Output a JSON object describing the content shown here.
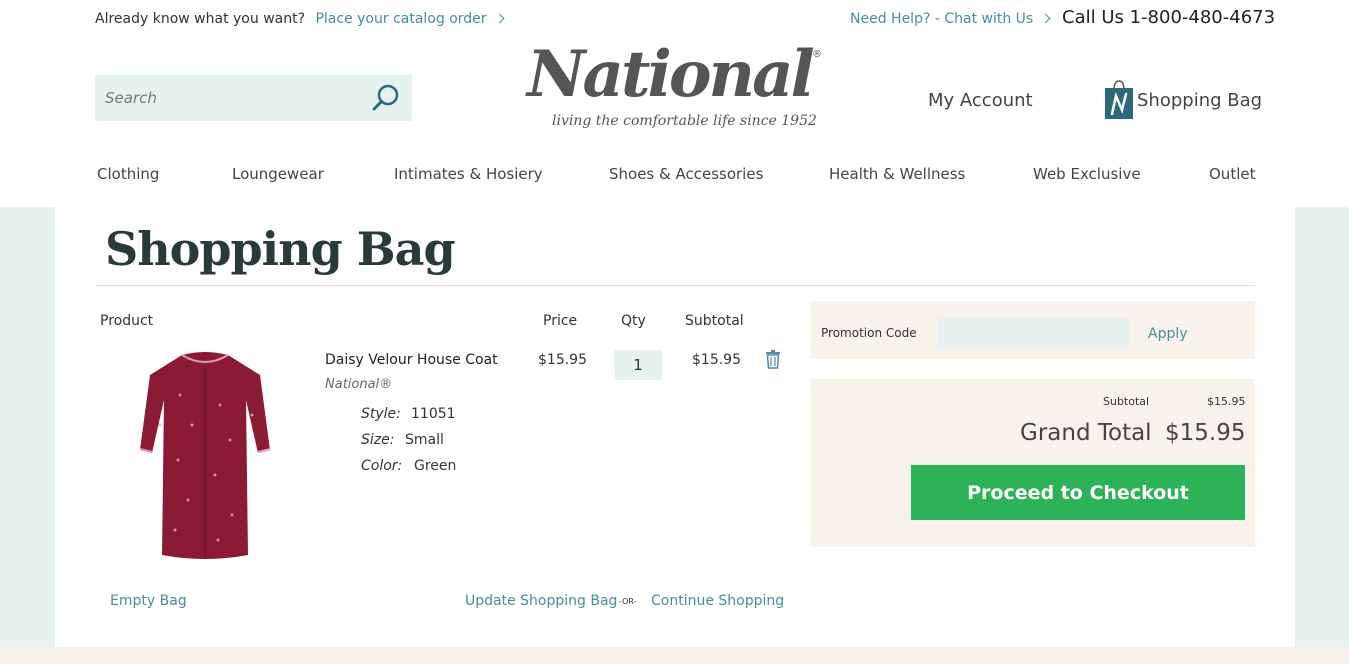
{
  "topbar": {
    "prompt": "Already know what you want?",
    "catalog_link": "Place your catalog order",
    "help_link": "Need Help? - Chat with Us",
    "call": "Call Us 1-800-480-4673"
  },
  "header": {
    "search_placeholder": "Search",
    "logo_word": "National",
    "logo_reg": "®",
    "logo_tagline": "living the comfortable life   since 1952",
    "my_account": "My Account",
    "shopping_bag": "Shopping Bag"
  },
  "nav": {
    "items": [
      "Clothing",
      "Loungewear",
      "Intimates & Hosiery",
      "Shoes & Accessories",
      "Health & Wellness",
      "Web Exclusive",
      "Outlet"
    ]
  },
  "page": {
    "title": "Shopping Bag"
  },
  "table": {
    "headers": {
      "product": "Product",
      "price": "Price",
      "qty": "Qty",
      "subtotal": "Subtotal"
    }
  },
  "item": {
    "name": "Daisy Velour House Coat",
    "brand": "National®",
    "style_label": "Style:",
    "style_value": "11051",
    "size_label": "Size:",
    "size_value": "Small",
    "color_label": "Color:",
    "color_value": "Green",
    "price": "$15.95",
    "qty": "1",
    "subtotal": "$15.95"
  },
  "actions": {
    "empty_bag": "Empty Bag",
    "update_bag": "Update Shopping Bag",
    "or": "-OR-",
    "continue": "Continue Shopping"
  },
  "promo": {
    "label": "Promotion Code",
    "apply": "Apply"
  },
  "summary": {
    "subtotal_label": "Subtotal",
    "subtotal_value": "$15.95",
    "grand_total_label": "Grand Total",
    "grand_total_value": "$15.95",
    "checkout": "Proceed to Checkout"
  },
  "colors": {
    "link": "#4a8c9c",
    "accent_bg": "#e6f2f0",
    "summary_bg": "#f7f3ec",
    "checkout": "#2db357",
    "robe": "#8b1a34"
  },
  "icons": {
    "search": "magnifier-icon",
    "bag": "shopping-bag-icon",
    "trash": "trash-icon"
  }
}
